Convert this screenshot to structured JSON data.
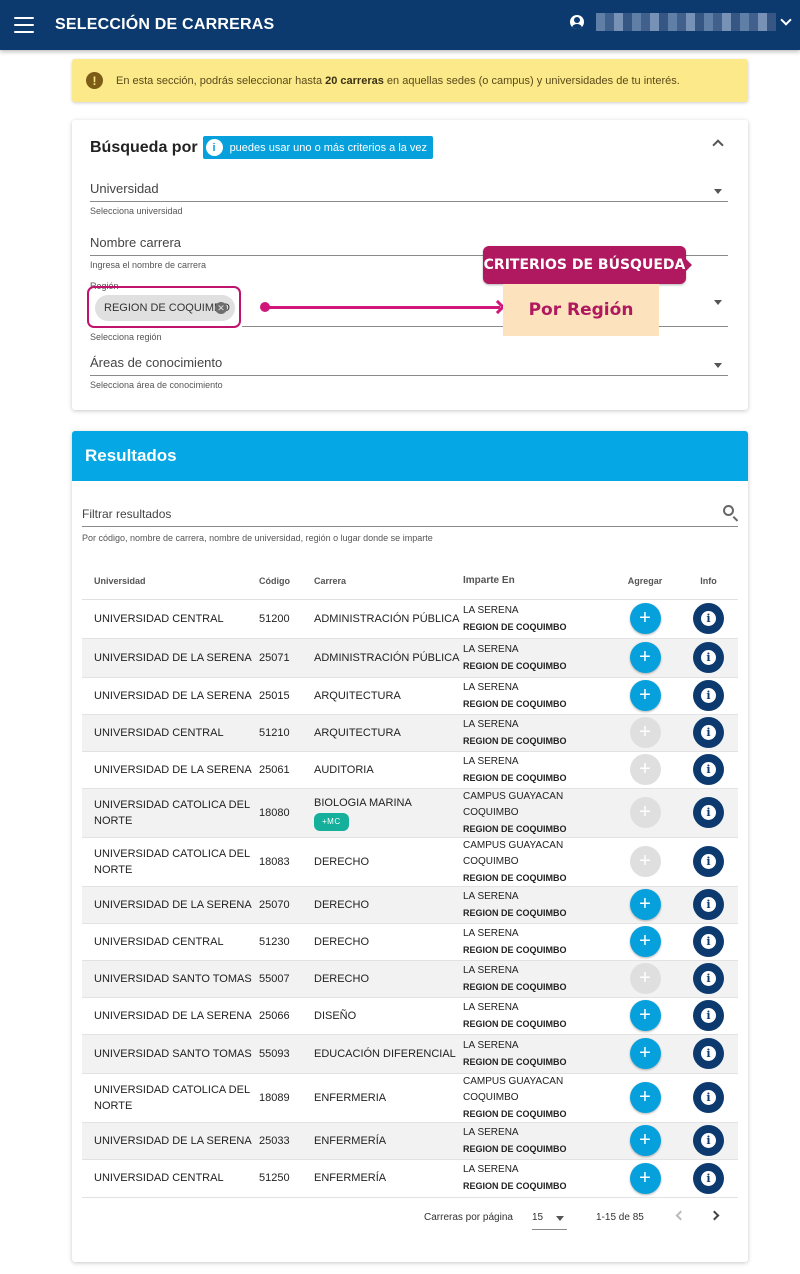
{
  "header": {
    "title": "SELECCIÓN DE CARRERAS"
  },
  "notice": {
    "icon": "exclamation-icon",
    "prefix": "En esta sección, podrás seleccionar hasta ",
    "bold": "20 carreras",
    "suffix": " en aquellas sedes (o campus) y universidades de tu interés."
  },
  "search": {
    "title": "Búsqueda por",
    "hint": "puedes usar uno o más criterios a la vez",
    "universidad": {
      "label": "Universidad",
      "help": "Selecciona universidad"
    },
    "carrera": {
      "label": "Nombre carrera",
      "help": "Ingresa el nombre de carrera"
    },
    "region": {
      "label": "Región",
      "chip": "REGION DE COQUIMBO",
      "help": "Selecciona región"
    },
    "areas": {
      "label": "Áreas de conocimiento",
      "help": "Selecciona área de conocimiento"
    }
  },
  "annotation": {
    "badge": "CRITERIOS DE BÚSQUEDA",
    "highlight": "Por Región"
  },
  "results": {
    "title": "Resultados",
    "filter_label": "Filtrar resultados",
    "filter_help": "Por código, nombre de carrera, nombre de universidad, región o lugar donde se imparte",
    "columns": [
      "Universidad",
      "Código",
      "Carrera",
      "Imparte En",
      "Agregar",
      "Info"
    ],
    "rows": [
      {
        "uni": "UNIVERSIDAD CENTRAL",
        "cod": "51200",
        "car": "ADMINISTRACIÓN PÚBLICA",
        "lugar": "LA SERENA",
        "reg": "REGION DE COQUIMBO",
        "enabled": true
      },
      {
        "uni": "UNIVERSIDAD DE LA SERENA",
        "cod": "25071",
        "car": "ADMINISTRACIÓN PÚBLICA",
        "lugar": "LA SERENA",
        "reg": "REGION DE COQUIMBO",
        "enabled": true
      },
      {
        "uni": "UNIVERSIDAD DE LA SERENA",
        "cod": "25015",
        "car": "ARQUITECTURA",
        "lugar": "LA SERENA",
        "reg": "REGION DE COQUIMBO",
        "enabled": true
      },
      {
        "uni": "UNIVERSIDAD CENTRAL",
        "cod": "51210",
        "car": "ARQUITECTURA",
        "lugar": "LA SERENA",
        "reg": "REGION DE COQUIMBO",
        "enabled": false
      },
      {
        "uni": "UNIVERSIDAD DE LA SERENA",
        "cod": "25061",
        "car": "AUDITORIA",
        "lugar": "LA SERENA",
        "reg": "REGION DE COQUIMBO",
        "enabled": false
      },
      {
        "uni": "UNIVERSIDAD CATOLICA DEL NORTE",
        "cod": "18080",
        "car": "BIOLOGIA MARINA",
        "badge": "+MC",
        "lugar": "CAMPUS GUAYACAN COQUIMBO",
        "reg": "REGION DE COQUIMBO",
        "enabled": false
      },
      {
        "uni": "UNIVERSIDAD CATOLICA DEL NORTE",
        "cod": "18083",
        "car": "DERECHO",
        "lugar": "CAMPUS GUAYACAN COQUIMBO",
        "reg": "REGION DE COQUIMBO",
        "enabled": false
      },
      {
        "uni": "UNIVERSIDAD DE LA SERENA",
        "cod": "25070",
        "car": "DERECHO",
        "lugar": "LA SERENA",
        "reg": "REGION DE COQUIMBO",
        "enabled": true
      },
      {
        "uni": "UNIVERSIDAD CENTRAL",
        "cod": "51230",
        "car": "DERECHO",
        "lugar": "LA SERENA",
        "reg": "REGION DE COQUIMBO",
        "enabled": true
      },
      {
        "uni": "UNIVERSIDAD SANTO TOMAS",
        "cod": "55007",
        "car": "DERECHO",
        "lugar": "LA SERENA",
        "reg": "REGION DE COQUIMBO",
        "enabled": false
      },
      {
        "uni": "UNIVERSIDAD DE LA SERENA",
        "cod": "25066",
        "car": "DISEÑO",
        "lugar": "LA SERENA",
        "reg": "REGION DE COQUIMBO",
        "enabled": true
      },
      {
        "uni": "UNIVERSIDAD SANTO TOMAS",
        "cod": "55093",
        "car": "EDUCACIÓN DIFERENCIAL",
        "lugar": "LA SERENA",
        "reg": "REGION DE COQUIMBO",
        "enabled": true
      },
      {
        "uni": "UNIVERSIDAD CATOLICA DEL NORTE",
        "cod": "18089",
        "car": "ENFERMERIA",
        "lugar": "CAMPUS GUAYACAN COQUIMBO",
        "reg": "REGION DE COQUIMBO",
        "enabled": true
      },
      {
        "uni": "UNIVERSIDAD DE LA SERENA",
        "cod": "25033",
        "car": "ENFERMERÍA",
        "lugar": "LA SERENA",
        "reg": "REGION DE COQUIMBO",
        "enabled": true
      },
      {
        "uni": "UNIVERSIDAD CENTRAL",
        "cod": "51250",
        "car": "ENFERMERÍA",
        "lugar": "LA SERENA",
        "reg": "REGION DE COQUIMBO",
        "enabled": true
      }
    ],
    "pager": {
      "label": "Carreras por página",
      "per_page": "15",
      "range": "1-15 de 85"
    }
  },
  "colors": {
    "topbar": "#0c3a6e",
    "accent": "#06a1dd",
    "notice": "#fbe98a",
    "annotation": "#b0185f"
  }
}
